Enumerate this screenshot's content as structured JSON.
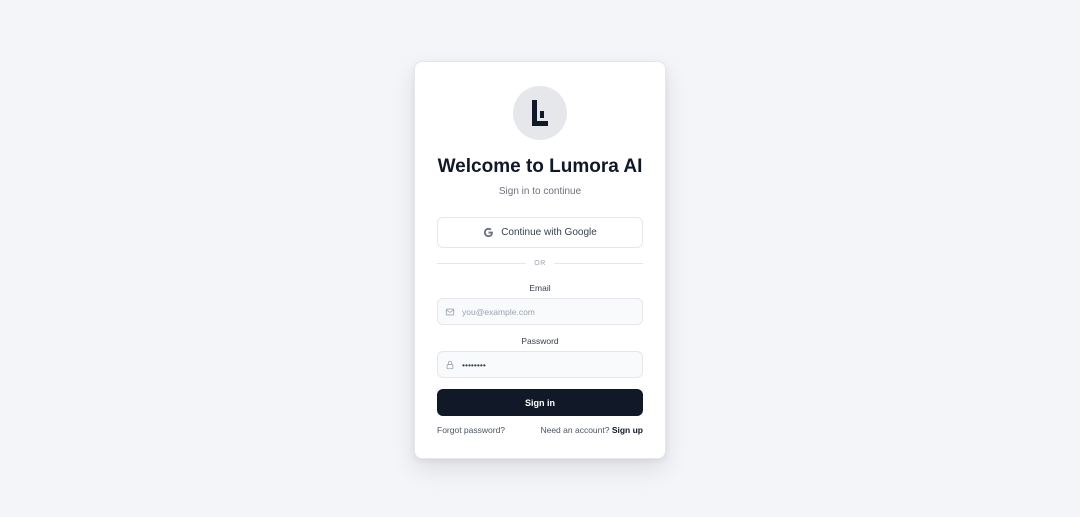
{
  "app": {
    "logo_letter": "L"
  },
  "header": {
    "title": "Welcome to Lumora AI",
    "subtitle": "Sign in to continue"
  },
  "google": {
    "label": "Continue with Google",
    "icon": "google-icon"
  },
  "divider": {
    "text": "OR"
  },
  "form": {
    "email": {
      "label": "Email",
      "placeholder": "you@example.com",
      "value": "",
      "icon": "mail-icon"
    },
    "password": {
      "label": "Password",
      "value": "••••••••",
      "icon": "lock-icon"
    },
    "submit_label": "Sign in"
  },
  "footer": {
    "forgot_label": "Forgot password?",
    "need_account_text": "Need an account?",
    "signup_label": "Sign up"
  },
  "colors": {
    "background": "#f3f5f8",
    "primary": "#111827",
    "muted_text": "#6b7280",
    "border": "#e5e7eb"
  }
}
